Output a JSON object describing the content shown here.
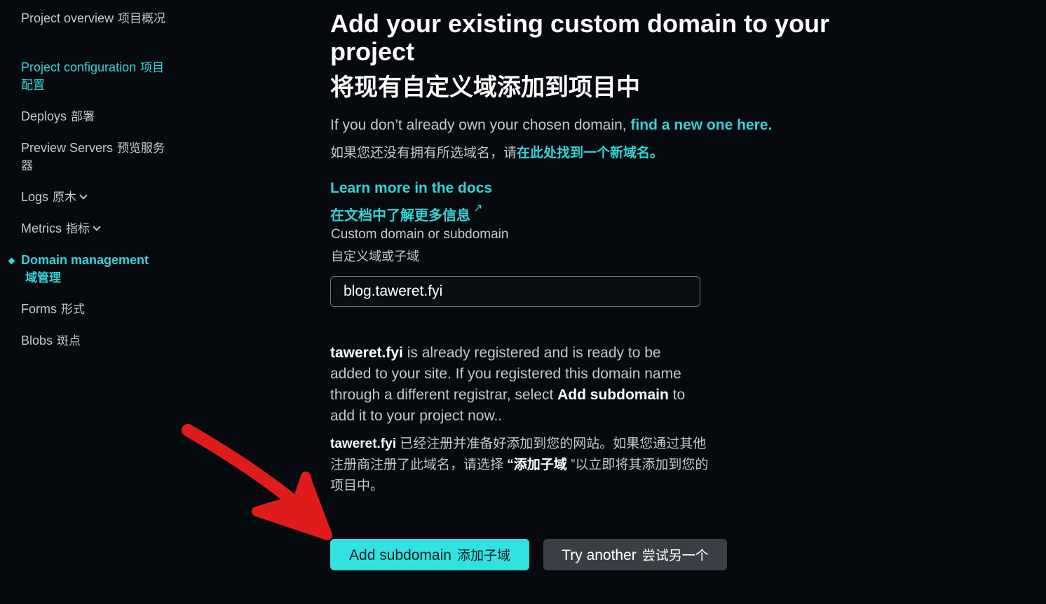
{
  "sidebar": {
    "items": [
      {
        "label": "Project overview",
        "cn": "项目概况"
      },
      {
        "label": "Project configuration",
        "cn": "项目配置"
      },
      {
        "label": "Deploys",
        "cn": "部署"
      },
      {
        "label": "Preview Servers",
        "cn": "预览服务器"
      },
      {
        "label": "Logs",
        "cn": "原木"
      },
      {
        "label": "Metrics",
        "cn": "指标"
      },
      {
        "label": "Domain management",
        "cn": "域管理"
      },
      {
        "label": "Forms",
        "cn": "形式"
      },
      {
        "label": "Blobs",
        "cn": "斑点"
      }
    ]
  },
  "main": {
    "title": "Add your existing custom domain to your project",
    "title_cn": "将现有自定义域添加到项目中",
    "intro_text": "If you don’t already own your chosen domain, ",
    "intro_link": "find a new one here.",
    "intro_cn_text": "如果您还没有拥有所选域名，请",
    "intro_cn_link": "在此处找到一个新域名。",
    "docs_link": "Learn more in the docs",
    "docs_link_cn": "在文档中了解更多信息",
    "field_label": "Custom domain or subdomain",
    "field_label_cn": "自定义域或子域",
    "domain_value": "blog.taweret.fyi",
    "desc_domain": "taweret.fyi",
    "desc_text_1": " is already registered and is ready to be added to your site. If you registered this domain name through a different registrar, select ",
    "desc_bold": "Add subdomain",
    "desc_text_2": " to add it to your project now..",
    "desc_cn_domain": "taweret.fyi",
    "desc_cn_text_1": " 已经注册并准备好添加到您的网站。如果您通过其他注册商注册了此域名，请选择 ",
    "desc_cn_bold": "“添加子域",
    "desc_cn_text_2": " ”以立即将其添加到您的项目中。",
    "btn_add": "Add subdomain",
    "btn_add_cn": "添加子域",
    "btn_try": "Try another",
    "btn_try_cn": "尝试另一个"
  },
  "colors": {
    "background": "#06090d",
    "accent": "#32d4d6",
    "button_primary": "#32e2e0",
    "button_secondary": "#3a3f46",
    "arrow": "#e01b1b"
  },
  "icons": {
    "external_link": "arrow-up-right-icon",
    "chevron": "chevron-down-icon",
    "active_marker": "diamond-icon"
  }
}
